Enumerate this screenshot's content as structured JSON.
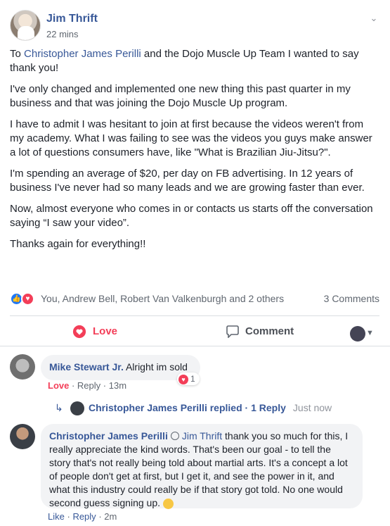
{
  "post": {
    "author": "Jim Thrift",
    "time": "22 mins",
    "paragraphs": {
      "p1_prefix": "To ",
      "p1_link": "Christopher James Perilli",
      "p1_suffix": " and the Dojo Muscle Up Team I wanted to say thank you!",
      "p2": "I've only changed and implemented one new thing this past quarter in my business and that was joining the Dojo Muscle Up program.",
      "p3": "I have to admit I was hesitant to join at first because the videos weren't from my academy. What I was failing to see was the videos you guys make answer a lot of questions consumers have, like \"What is Brazilian Jiu-Jitsu?\".",
      "p4": "I'm spending an average of $20, per day on FB advertising. In 12 years of business I've never had so many leads and we are growing faster than ever.",
      "p5": "Now, almost everyone who comes in or contacts us starts off the conversation saying “I saw your video”.",
      "p6": "Thanks again for everything!!"
    },
    "reactions_text": "You, Andrew Bell, Robert Van Valkenburgh and 2 others",
    "comment_count": "3 Comments",
    "actions": {
      "love": "Love",
      "comment": "Comment"
    }
  },
  "comments": [
    {
      "author": "Mike Stewart Jr.",
      "text": "Alright im sold",
      "love": "Love",
      "reply": "Reply",
      "time": "13m",
      "reaction_count": "1",
      "replies_summary": {
        "author": "Christopher James Perilli",
        "action": "replied",
        "count": "1 Reply",
        "time": "Just now"
      }
    },
    {
      "author": "Christopher James Perilli",
      "mention": "Jim Thrift",
      "text": "thank you so much for this, I really appreciate the kind words. That's been our goal - to tell the story that's not really being told about martial arts. It's a concept a lot of people don't get at first, but I get it, and see the power in it, and what this industry could really be if that story got told. No one would second guess signing up.",
      "like": "Like",
      "reply": "Reply",
      "time": "2m"
    }
  ],
  "colors": {
    "link": "#385898",
    "love": "#f33e58",
    "like": "#2078f4",
    "meta": "#606770",
    "bubble": "#f2f3f5"
  }
}
